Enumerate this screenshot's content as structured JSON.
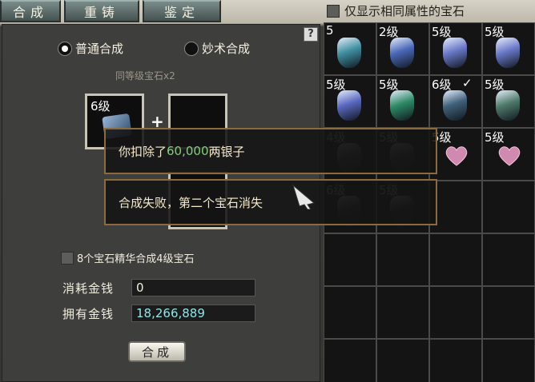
{
  "tabs": [
    "合成",
    "重铸",
    "鉴定"
  ],
  "filter_label": "仅显示相同属性的宝石",
  "help_label": "?",
  "modes": {
    "normal": "普通合成",
    "special": "妙术合成"
  },
  "requirement": "同等级宝石x2",
  "slot_level": "6级",
  "essence_option": "8个宝石精华合成4级宝石",
  "cost": {
    "label": "消耗金钱",
    "value": "0"
  },
  "owned": {
    "label": "拥有金钱",
    "value": "18,266,889"
  },
  "combine_button": "合成",
  "popup1": {
    "prefix": "你扣除了",
    "amount": "60,000",
    "suffix": "两银子"
  },
  "popup2": "合成失败，第二个宝石消失",
  "inventory": [
    {
      "level": "5",
      "color": "#3f8fa0",
      "kind": "gem"
    },
    {
      "level": "2级",
      "color": "#4a68b8",
      "kind": "gem"
    },
    {
      "level": "5级",
      "color": "#6a78c8",
      "kind": "gem"
    },
    {
      "level": "5级",
      "color": "#6a78c8",
      "kind": "gem"
    },
    {
      "level": "5级",
      "color": "#5a68c0",
      "kind": "gem"
    },
    {
      "level": "5级",
      "color": "#2e8a66",
      "kind": "gem"
    },
    {
      "level": "6级",
      "color": "#40607a",
      "kind": "gem",
      "check": "✓"
    },
    {
      "level": "5级",
      "color": "#4f7a6a",
      "kind": "gem"
    },
    {
      "level": "4级",
      "color": "#555",
      "kind": "gem",
      "dim": true
    },
    {
      "level": "5级",
      "color": "#444",
      "kind": "gem",
      "dim": true
    },
    {
      "level": "5级",
      "color": "#d08ab0",
      "kind": "heart"
    },
    {
      "level": "5级",
      "color": "#d08ab0",
      "kind": "heart"
    },
    {
      "level": "6级",
      "color": "#333",
      "kind": "gem",
      "dim": true
    },
    {
      "level": "5级",
      "color": "#2a2a2a",
      "kind": "gem",
      "dim": true
    }
  ],
  "colors": {
    "accent_green": "#7ed17b",
    "money_cyan": "#8fe6e6",
    "popup_border": "#8a6a3e"
  }
}
